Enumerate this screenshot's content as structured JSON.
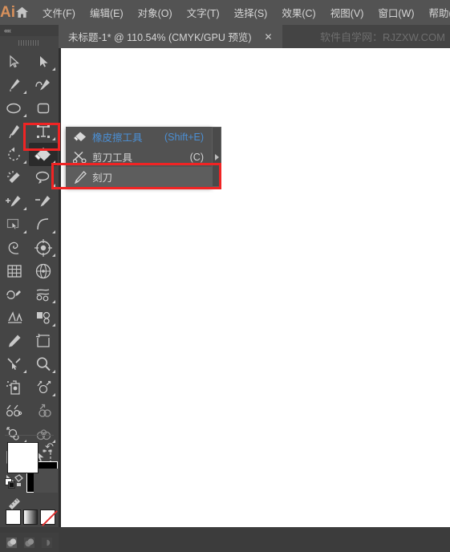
{
  "app": {
    "logo_text": "Ai",
    "home_icon": "home-icon"
  },
  "menubar": {
    "items": [
      {
        "label": "文件(F)",
        "name": "menu-file"
      },
      {
        "label": "编辑(E)",
        "name": "menu-edit"
      },
      {
        "label": "对象(O)",
        "name": "menu-object"
      },
      {
        "label": "文字(T)",
        "name": "menu-type"
      },
      {
        "label": "选择(S)",
        "name": "menu-select"
      },
      {
        "label": "效果(C)",
        "name": "menu-effect"
      },
      {
        "label": "视图(V)",
        "name": "menu-view"
      },
      {
        "label": "窗口(W)",
        "name": "menu-window"
      },
      {
        "label": "帮助(",
        "name": "menu-help"
      }
    ]
  },
  "tabbar": {
    "document_tab": {
      "title": "未标题-1* @ 110.54% (CMYK/GPU 预览)",
      "close_label": "✕"
    },
    "watermark": "软件自学网：RJZXW.COM"
  },
  "toolbar": {
    "collapse_label": "««",
    "grip_name": "panel-grip",
    "selected_tool": "eraser-tool",
    "tools": [
      {
        "name": "selection-tool",
        "has_triangle": false
      },
      {
        "name": "direct-selection-tool",
        "has_triangle": true
      },
      {
        "name": "pen-tool",
        "has_triangle": true
      },
      {
        "name": "curvature-tool",
        "has_triangle": false
      },
      {
        "name": "ellipse-tool",
        "has_triangle": true
      },
      {
        "name": "rectangle-tool",
        "has_triangle": false
      },
      {
        "name": "paintbrush-tool",
        "has_triangle": false
      },
      {
        "name": "type-tool",
        "has_triangle": true
      },
      {
        "name": "rotate-tool",
        "has_triangle": true
      },
      {
        "name": "eraser-tool",
        "has_triangle": true
      },
      {
        "name": "magic-wand-tool",
        "has_triangle": false
      },
      {
        "name": "lasso-tool",
        "has_triangle": true
      },
      {
        "name": "add-anchor-point-tool",
        "has_triangle": true
      },
      {
        "name": "delete-anchor-point-tool",
        "has_triangle": false
      },
      {
        "name": "free-transform-tool",
        "has_triangle": true
      },
      {
        "name": "arc-tool",
        "has_triangle": true
      },
      {
        "name": "spiral-tool",
        "has_triangle": false
      },
      {
        "name": "shape-builder-tool",
        "has_triangle": true
      },
      {
        "name": "grid-tool",
        "has_triangle": false
      },
      {
        "name": "perspective-grid-tool",
        "has_triangle": false
      },
      {
        "name": "smooth-tool",
        "has_triangle": false
      },
      {
        "name": "width-tool",
        "has_triangle": true
      },
      {
        "name": "blend-tool",
        "has_triangle": false
      },
      {
        "name": "gradient-tool",
        "has_triangle": true
      },
      {
        "name": "pencil-tool",
        "has_triangle": false
      },
      {
        "name": "artboard-tool",
        "has_triangle": false
      },
      {
        "name": "scale-tool",
        "has_triangle": true
      },
      {
        "name": "zoom-tool",
        "has_triangle": true
      },
      {
        "name": "symbol-sprayer-tool",
        "has_triangle": false
      },
      {
        "name": "scatter-tool",
        "has_triangle": true
      },
      {
        "name": "graph-tool",
        "has_triangle": false
      },
      {
        "name": "mesh-tool",
        "has_triangle": true
      },
      {
        "name": "puppet-warp-tool",
        "has_triangle": true
      },
      {
        "name": "live-paint-tool",
        "has_triangle": true
      },
      {
        "name": "perspective-selection-tool",
        "has_triangle": false
      },
      {
        "name": "slice-tool",
        "has_triangle": true
      },
      {
        "name": "print-tiling-tool",
        "has_triangle": false
      },
      {
        "name": "measure-tool",
        "has_triangle": false
      },
      {
        "name": "ruler-tool",
        "has_triangle": false
      }
    ],
    "fill_color": "#ffffff",
    "stroke_color": "#000000",
    "swap_icon": "swap-fill-stroke-icon",
    "default_icon": "default-fill-stroke-icon",
    "modes": [
      {
        "name": "color-mode-swatch",
        "kind": "color"
      },
      {
        "name": "gradient-mode-swatch",
        "kind": "gradient"
      },
      {
        "name": "none-mode-swatch",
        "kind": "none"
      }
    ],
    "draw_modes": [
      {
        "name": "draw-normal-mode"
      },
      {
        "name": "draw-behind-mode"
      },
      {
        "name": "draw-inside-mode"
      }
    ]
  },
  "flyout": {
    "name": "eraser-tool-flyout",
    "items": [
      {
        "name": "flyout-item-eraser",
        "label": "橡皮擦工具",
        "shortcut": "(Shift+E)",
        "icon": "eraser-icon",
        "state": "active",
        "submenu_arrow": false
      },
      {
        "name": "flyout-item-scissors",
        "label": "剪刀工具",
        "shortcut": "(C)",
        "icon": "scissors-icon",
        "state": "normal",
        "submenu_arrow": false
      },
      {
        "name": "flyout-item-knife",
        "label": "刻刀",
        "shortcut": "",
        "icon": "knife-icon",
        "state": "hover",
        "submenu_arrow": false
      }
    ],
    "tearoff_name": "tearoff-strip",
    "tearoff_icon": "tearoff-triangle-icon"
  },
  "annotations": [
    {
      "name": "highlight-eraser-toolbutton",
      "color": "#f02424"
    },
    {
      "name": "highlight-knife-menuitem",
      "color": "#f02424"
    }
  ],
  "colors": {
    "menubar_bg": "#535353",
    "tabbar_bg": "#444444",
    "panel_bg": "#454545",
    "flyout_bg": "#525252",
    "accent_blue": "#4b8fd4",
    "annotation_red": "#f02424",
    "canvas": "#ffffff"
  }
}
